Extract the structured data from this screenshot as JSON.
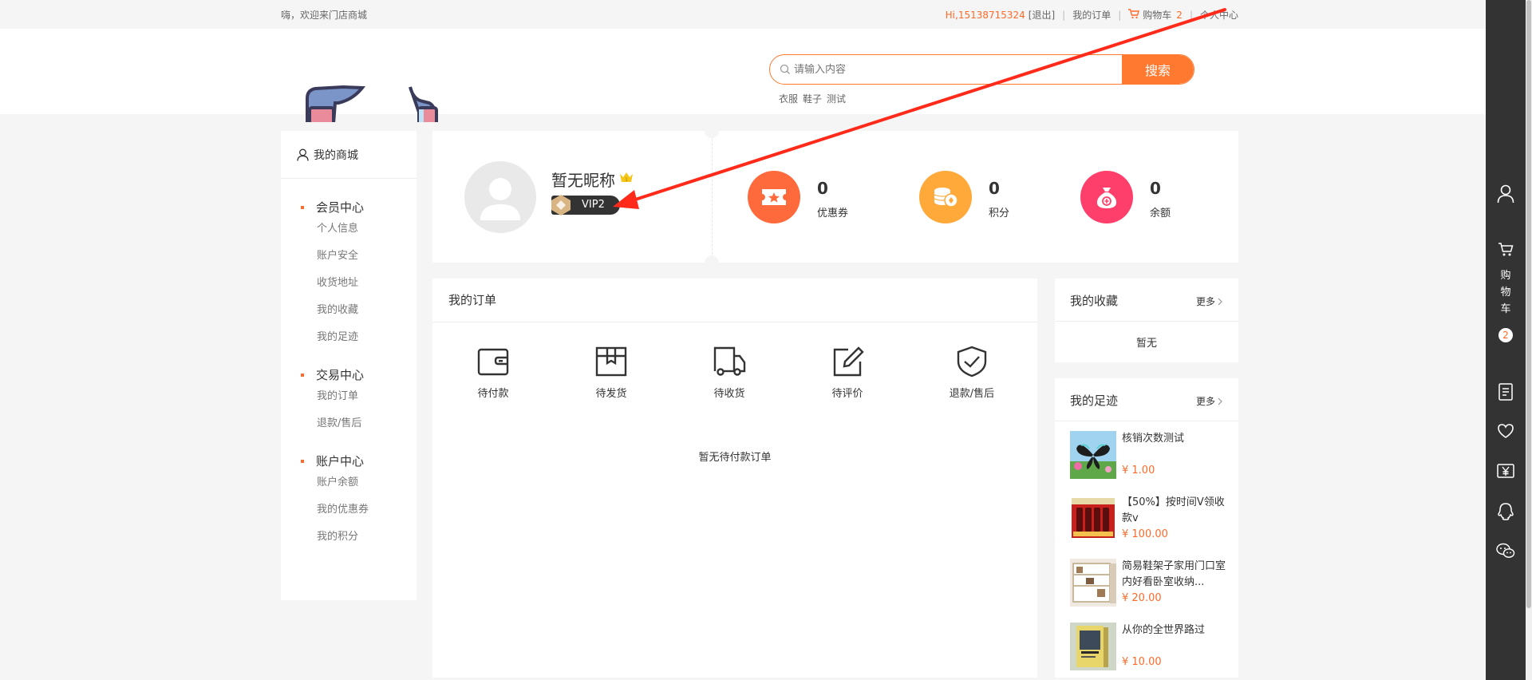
{
  "topbar": {
    "welcome": "嗨，欢迎来门店商城",
    "user_greeting": "Hi,15138715324",
    "logout": "[退出]",
    "my_orders": "我的订单",
    "cart_label": "购物车",
    "cart_count": "2",
    "personal_center": "个人中心"
  },
  "search": {
    "placeholder": "请输入内容",
    "button": "搜索",
    "hot_words": [
      "衣服",
      "鞋子",
      "测试"
    ]
  },
  "sidebar": {
    "title": "我的商城",
    "groups": [
      {
        "title": "会员中心",
        "items": [
          "个人信息",
          "账户安全",
          "收货地址",
          "我的收藏",
          "我的足迹"
        ]
      },
      {
        "title": "交易中心",
        "items": [
          "我的订单",
          "退款/售后"
        ]
      },
      {
        "title": "账户中心",
        "items": [
          "账户余额",
          "我的优惠券",
          "我的积分"
        ]
      }
    ]
  },
  "profile": {
    "nickname": "暂无昵称",
    "level": "VIP2",
    "stats": [
      {
        "value": "0",
        "label": "优惠券",
        "color": "#ff6a3c",
        "icon": "coupon-icon"
      },
      {
        "value": "0",
        "label": "积分",
        "color": "#ffa93a",
        "icon": "coins-icon"
      },
      {
        "value": "0",
        "label": "余额",
        "color": "#ff3f6b",
        "icon": "money-bag-icon"
      }
    ]
  },
  "orders": {
    "title": "我的订单",
    "statuses": [
      {
        "label": "待付款",
        "icon": "wallet-icon"
      },
      {
        "label": "待发货",
        "icon": "box-icon"
      },
      {
        "label": "待收货",
        "icon": "truck-icon"
      },
      {
        "label": "待评价",
        "icon": "edit-icon"
      },
      {
        "label": "退款/售后",
        "icon": "shield-check-icon"
      }
    ],
    "empty_text": "暂无待付款订单"
  },
  "favorites": {
    "title": "我的收藏",
    "more": "更多",
    "empty": "暂无"
  },
  "footprints": {
    "title": "我的足迹",
    "more": "更多",
    "items": [
      {
        "name": "核销次数测试",
        "price": "¥ 1.00"
      },
      {
        "name": "【50%】按时间V领收款v",
        "price": "¥ 100.00"
      },
      {
        "name": "简易鞋架子家用门口室内好看卧室收纳...",
        "price": "¥ 20.00"
      },
      {
        "name": "从你的全世界路过",
        "price": "¥ 10.00"
      }
    ]
  },
  "rail": {
    "cart_label": "购物车",
    "cart_count": "2"
  },
  "colors": {
    "accent": "#ff7a30",
    "price": "#ff6a28",
    "rail": "#333333",
    "annotation_arrow": "#ff2a1a"
  }
}
